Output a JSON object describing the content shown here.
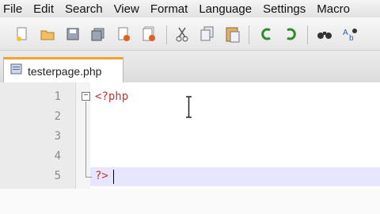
{
  "menubar": {
    "items": [
      "File",
      "Edit",
      "Search",
      "View",
      "Format",
      "Language",
      "Settings",
      "Macro"
    ]
  },
  "toolbar": {
    "icons": [
      "new-file-icon",
      "open-folder-icon",
      "save-icon",
      "save-all-icon",
      "close-file-icon",
      "close-all-icon",
      "cut-icon",
      "copy-icon",
      "paste-icon",
      "undo-icon",
      "redo-icon",
      "find-icon",
      "replace-icon"
    ]
  },
  "tab": {
    "label": "testerpage.php",
    "accent_color": "#f4a02c"
  },
  "editor": {
    "line_numbers": [
      "1",
      "2",
      "3",
      "4",
      "5"
    ],
    "lines": [
      "<?php",
      "",
      "",
      "",
      "?>"
    ],
    "current_line_color": "#e8e6ff",
    "keyword_color": "#c0392b"
  }
}
